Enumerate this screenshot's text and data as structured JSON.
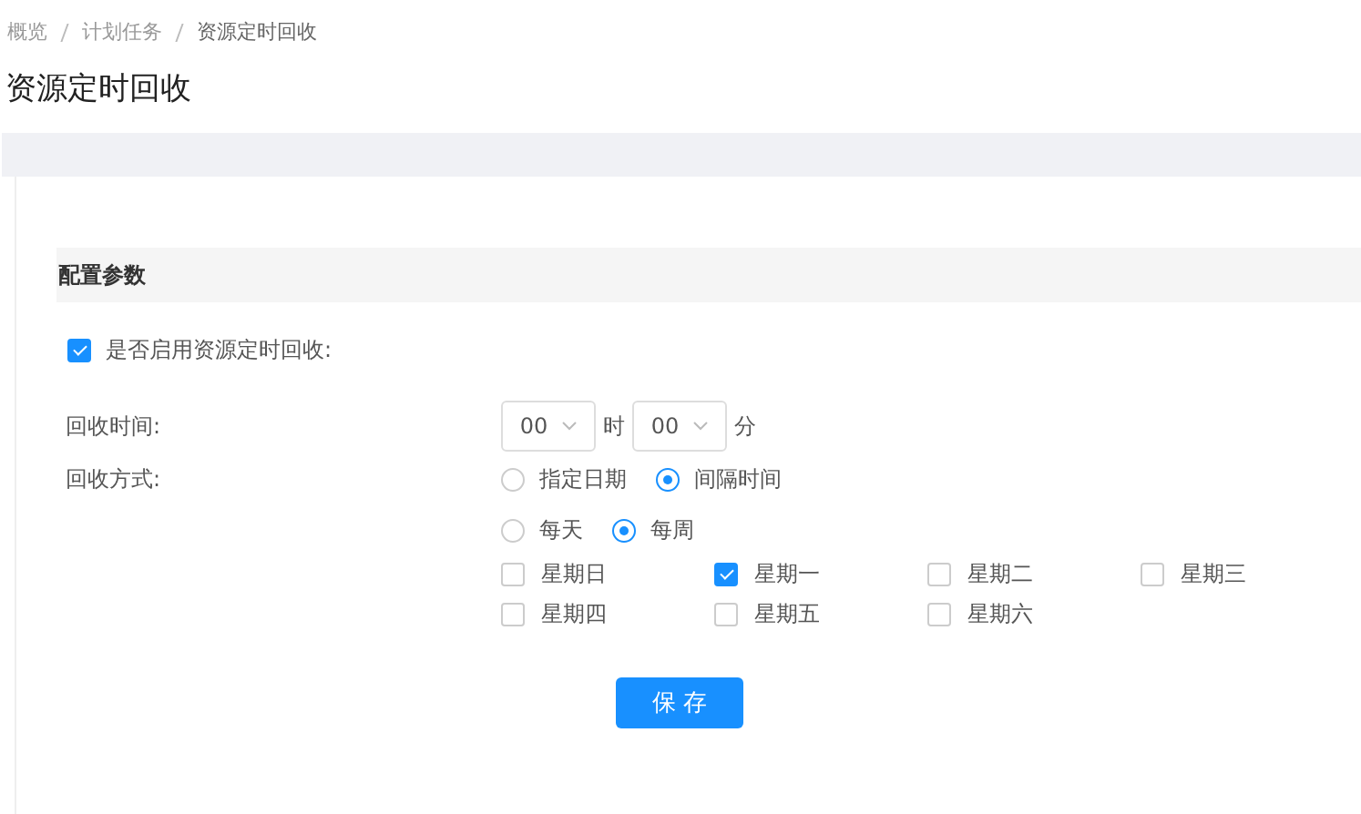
{
  "breadcrumb": [
    {
      "label": "概览"
    },
    {
      "label": "计划任务"
    },
    {
      "label": "资源定时回收"
    }
  ],
  "title": "资源定时回收",
  "section_title": "配置参数",
  "enable": {
    "label": "是否启用资源定时回收:",
    "checked": true
  },
  "time": {
    "label": "回收时间:",
    "hour": "00",
    "hour_unit": "时",
    "minute": "00",
    "minute_unit": "分"
  },
  "mode": {
    "label": "回收方式:",
    "options": [
      {
        "label": "指定日期",
        "selected": false
      },
      {
        "label": "间隔时间",
        "selected": true
      }
    ]
  },
  "interval": [
    {
      "label": "每天",
      "selected": false
    },
    {
      "label": "每周",
      "selected": true
    }
  ],
  "weekdays": [
    {
      "label": "星期日",
      "checked": false
    },
    {
      "label": "星期一",
      "checked": true
    },
    {
      "label": "星期二",
      "checked": false
    },
    {
      "label": "星期三",
      "checked": false
    },
    {
      "label": "星期四",
      "checked": false
    },
    {
      "label": "星期五",
      "checked": false
    },
    {
      "label": "星期六",
      "checked": false
    }
  ],
  "save_button": "保 存"
}
